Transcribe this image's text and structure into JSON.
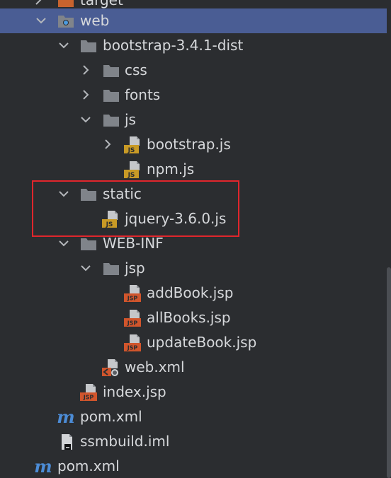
{
  "tree": {
    "items": [
      {
        "label": "target"
      },
      {
        "label": "web"
      },
      {
        "label": "bootstrap-3.4.1-dist"
      },
      {
        "label": "css"
      },
      {
        "label": "fonts"
      },
      {
        "label": "js"
      },
      {
        "label": "bootstrap.js"
      },
      {
        "label": "npm.js"
      },
      {
        "label": "static"
      },
      {
        "label": "jquery-3.6.0.js"
      },
      {
        "label": "WEB-INF"
      },
      {
        "label": "jsp"
      },
      {
        "label": "addBook.jsp"
      },
      {
        "label": "allBooks.jsp"
      },
      {
        "label": "updateBook.jsp"
      },
      {
        "label": "web.xml"
      },
      {
        "label": "index.jsp"
      },
      {
        "label": "pom.xml"
      },
      {
        "label": "ssmbuild.iml"
      },
      {
        "label": "pom.xml"
      }
    ],
    "icon_badges": {
      "js": "JS",
      "jsp": "JSP",
      "maven": "m"
    }
  },
  "colors": {
    "background": "#2b2d30",
    "selection": "#4a5d94",
    "folder": "#7f8389",
    "js_badge": "#c89a26",
    "jsp_badge": "#d0552c",
    "maven": "#4c8cd6",
    "highlight_box": "#e0262c"
  }
}
